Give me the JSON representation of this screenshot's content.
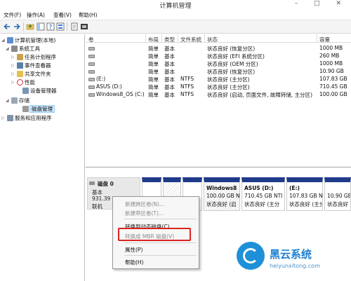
{
  "window": {
    "title": "计算机管理",
    "controls": "– □ ✕"
  },
  "menubar": {
    "items": [
      "文件(F)",
      "操作(A)",
      "查看(V)",
      "帮助(H)"
    ]
  },
  "toolbar": {
    "icons": [
      "back-arrow-icon",
      "forward-arrow-icon",
      "up-folder-icon",
      "show-hide-tree-icon",
      "help-icon",
      "console-view-icon",
      "properties-icon",
      "connect-icon"
    ]
  },
  "tree": {
    "root": "计算机管理(本地)",
    "items": [
      "系统工具",
      "任务计划程序",
      "事件查看器",
      "共享文件夹",
      "性能",
      "设备管理器",
      "存储",
      "磁盘管理",
      "服务和应用程序"
    ]
  },
  "volume_table": {
    "columns": [
      "卷",
      "布局",
      "类型",
      "文件系统",
      "状态",
      "容量"
    ],
    "rows": [
      {
        "vol": "",
        "layout": "简单",
        "type": "基本",
        "fs": "",
        "status": "状态良好 (恢复分区)",
        "cap": "1000 MB"
      },
      {
        "vol": "",
        "layout": "简单",
        "type": "基本",
        "fs": "",
        "status": "状态良好 (EFI 系统分区)",
        "cap": "260 MB"
      },
      {
        "vol": "",
        "layout": "简单",
        "type": "基本",
        "fs": "",
        "status": "状态良好 (OEM 分区)",
        "cap": "1000 MB"
      },
      {
        "vol": "",
        "layout": "简单",
        "type": "基本",
        "fs": "",
        "status": "状态良好 (恢复分区)",
        "cap": "10.90 GB"
      },
      {
        "vol": "(E:)",
        "layout": "简单",
        "type": "基本",
        "fs": "NTFS",
        "status": "状态良好 (主分区)",
        "cap": "107.83 GB"
      },
      {
        "vol": "ASUS (D:)",
        "layout": "简单",
        "type": "基本",
        "fs": "NTFS",
        "status": "状态良好 (主分区)",
        "cap": "710.45 GB"
      },
      {
        "vol": "Windows8_OS (C:)",
        "layout": "简单",
        "type": "基本",
        "fs": "NTFS",
        "status": "状态良好 (启动, 页面文件, 故障转储, 主分区)",
        "cap": "100.00 GB"
      }
    ]
  },
  "disk": {
    "name": "磁盘 0",
    "type": "基本",
    "size": "931.39",
    "state": "联机",
    "partitions": [
      {
        "name": "",
        "size": "",
        "status": ""
      },
      {
        "name": "",
        "size": "",
        "status": ""
      },
      {
        "name": "",
        "size": "",
        "status": ""
      },
      {
        "name": "Windows8",
        "size": "100.00 GB N",
        "status": "状态良好 (启"
      },
      {
        "name": "ASUS (D:)",
        "size": "710.45 GB NTI",
        "status": "状态良好 (主分"
      },
      {
        "name": "(E:)",
        "size": "107.83 GB NT",
        "status": "状态良好 (主分"
      },
      {
        "name": "",
        "size": "10.90 GB",
        "status": "状态良好"
      }
    ]
  },
  "context_menu": {
    "items": [
      "新建跨区卷(N)...",
      "新建带区卷(T)...",
      "转换到动态磁盘(C)...",
      "转换成 MBR 磁盘(V)",
      "属性(P)",
      "帮助(H)"
    ]
  },
  "watermark": {
    "brand": "黑云系统",
    "url": "heiyunxitong.com"
  }
}
